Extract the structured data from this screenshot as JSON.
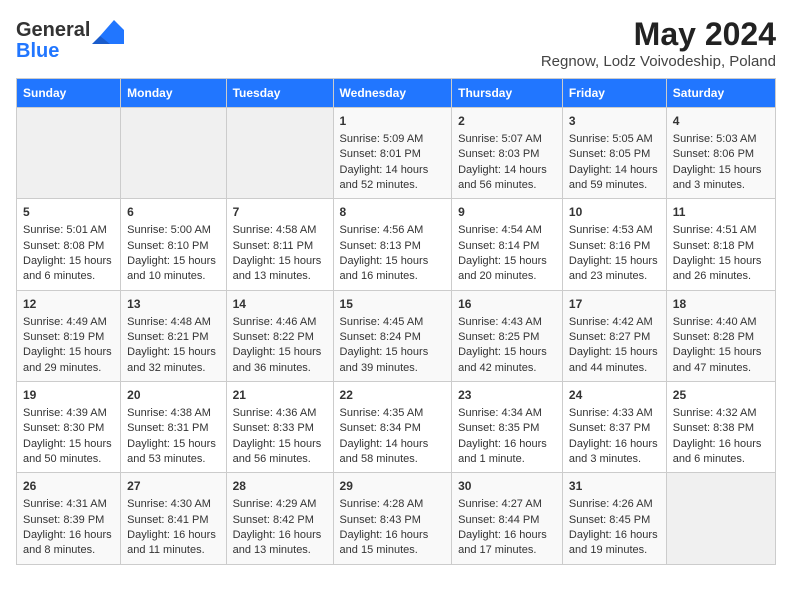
{
  "header": {
    "logo_general": "General",
    "logo_blue": "Blue",
    "title": "May 2024",
    "subtitle": "Regnow, Lodz Voivodeship, Poland"
  },
  "days_of_week": [
    "Sunday",
    "Monday",
    "Tuesday",
    "Wednesday",
    "Thursday",
    "Friday",
    "Saturday"
  ],
  "weeks": [
    [
      {
        "day": "",
        "empty": true
      },
      {
        "day": "",
        "empty": true
      },
      {
        "day": "",
        "empty": true
      },
      {
        "day": "1",
        "sunrise": "5:09 AM",
        "sunset": "8:01 PM",
        "daylight": "14 hours and 52 minutes."
      },
      {
        "day": "2",
        "sunrise": "5:07 AM",
        "sunset": "8:03 PM",
        "daylight": "14 hours and 56 minutes."
      },
      {
        "day": "3",
        "sunrise": "5:05 AM",
        "sunset": "8:05 PM",
        "daylight": "14 hours and 59 minutes."
      },
      {
        "day": "4",
        "sunrise": "5:03 AM",
        "sunset": "8:06 PM",
        "daylight": "15 hours and 3 minutes."
      }
    ],
    [
      {
        "day": "5",
        "sunrise": "5:01 AM",
        "sunset": "8:08 PM",
        "daylight": "15 hours and 6 minutes."
      },
      {
        "day": "6",
        "sunrise": "5:00 AM",
        "sunset": "8:10 PM",
        "daylight": "15 hours and 10 minutes."
      },
      {
        "day": "7",
        "sunrise": "4:58 AM",
        "sunset": "8:11 PM",
        "daylight": "15 hours and 13 minutes."
      },
      {
        "day": "8",
        "sunrise": "4:56 AM",
        "sunset": "8:13 PM",
        "daylight": "15 hours and 16 minutes."
      },
      {
        "day": "9",
        "sunrise": "4:54 AM",
        "sunset": "8:14 PM",
        "daylight": "15 hours and 20 minutes."
      },
      {
        "day": "10",
        "sunrise": "4:53 AM",
        "sunset": "8:16 PM",
        "daylight": "15 hours and 23 minutes."
      },
      {
        "day": "11",
        "sunrise": "4:51 AM",
        "sunset": "8:18 PM",
        "daylight": "15 hours and 26 minutes."
      }
    ],
    [
      {
        "day": "12",
        "sunrise": "4:49 AM",
        "sunset": "8:19 PM",
        "daylight": "15 hours and 29 minutes."
      },
      {
        "day": "13",
        "sunrise": "4:48 AM",
        "sunset": "8:21 PM",
        "daylight": "15 hours and 32 minutes."
      },
      {
        "day": "14",
        "sunrise": "4:46 AM",
        "sunset": "8:22 PM",
        "daylight": "15 hours and 36 minutes."
      },
      {
        "day": "15",
        "sunrise": "4:45 AM",
        "sunset": "8:24 PM",
        "daylight": "15 hours and 39 minutes."
      },
      {
        "day": "16",
        "sunrise": "4:43 AM",
        "sunset": "8:25 PM",
        "daylight": "15 hours and 42 minutes."
      },
      {
        "day": "17",
        "sunrise": "4:42 AM",
        "sunset": "8:27 PM",
        "daylight": "15 hours and 44 minutes."
      },
      {
        "day": "18",
        "sunrise": "4:40 AM",
        "sunset": "8:28 PM",
        "daylight": "15 hours and 47 minutes."
      }
    ],
    [
      {
        "day": "19",
        "sunrise": "4:39 AM",
        "sunset": "8:30 PM",
        "daylight": "15 hours and 50 minutes."
      },
      {
        "day": "20",
        "sunrise": "4:38 AM",
        "sunset": "8:31 PM",
        "daylight": "15 hours and 53 minutes."
      },
      {
        "day": "21",
        "sunrise": "4:36 AM",
        "sunset": "8:33 PM",
        "daylight": "15 hours and 56 minutes."
      },
      {
        "day": "22",
        "sunrise": "4:35 AM",
        "sunset": "8:34 PM",
        "daylight": "14 hours and 58 minutes."
      },
      {
        "day": "23",
        "sunrise": "4:34 AM",
        "sunset": "8:35 PM",
        "daylight": "16 hours and 1 minute."
      },
      {
        "day": "24",
        "sunrise": "4:33 AM",
        "sunset": "8:37 PM",
        "daylight": "16 hours and 3 minutes."
      },
      {
        "day": "25",
        "sunrise": "4:32 AM",
        "sunset": "8:38 PM",
        "daylight": "16 hours and 6 minutes."
      }
    ],
    [
      {
        "day": "26",
        "sunrise": "4:31 AM",
        "sunset": "8:39 PM",
        "daylight": "16 hours and 8 minutes."
      },
      {
        "day": "27",
        "sunrise": "4:30 AM",
        "sunset": "8:41 PM",
        "daylight": "16 hours and 11 minutes."
      },
      {
        "day": "28",
        "sunrise": "4:29 AM",
        "sunset": "8:42 PM",
        "daylight": "16 hours and 13 minutes."
      },
      {
        "day": "29",
        "sunrise": "4:28 AM",
        "sunset": "8:43 PM",
        "daylight": "16 hours and 15 minutes."
      },
      {
        "day": "30",
        "sunrise": "4:27 AM",
        "sunset": "8:44 PM",
        "daylight": "16 hours and 17 minutes."
      },
      {
        "day": "31",
        "sunrise": "4:26 AM",
        "sunset": "8:45 PM",
        "daylight": "16 hours and 19 minutes."
      },
      {
        "day": "",
        "empty": true
      }
    ]
  ],
  "labels": {
    "sunrise": "Sunrise:",
    "sunset": "Sunset:",
    "daylight": "Daylight:"
  }
}
